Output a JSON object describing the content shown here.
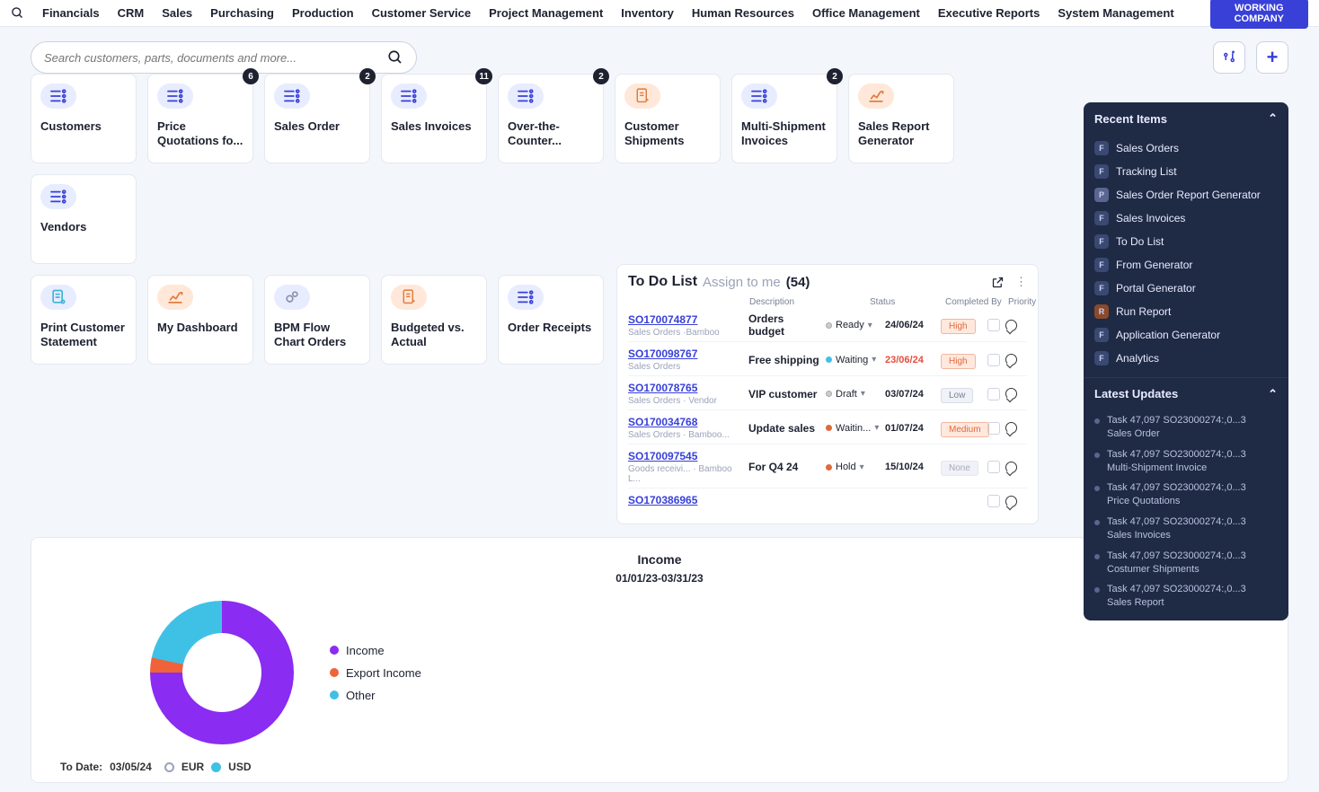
{
  "nav": [
    "Financials",
    "CRM",
    "Sales",
    "Purchasing",
    "Production",
    "Customer Service",
    "Project Management",
    "Inventory",
    "Human Resources",
    "Office Management",
    "Executive Reports",
    "System Management"
  ],
  "working_btn": "WORKING COMPANY",
  "search_placeholder": "Search customers, parts, documents and more...",
  "tiles_row1": [
    {
      "label": "Customers",
      "badge": null,
      "icon": "list"
    },
    {
      "label": "Price Quotations fo...",
      "badge": "6",
      "icon": "list"
    },
    {
      "label": "Sales Order",
      "badge": "2",
      "icon": "list"
    },
    {
      "label": "Sales Invoices",
      "badge": "11",
      "icon": "list"
    },
    {
      "label": "Over-the-Counter...",
      "badge": "2",
      "icon": "list"
    },
    {
      "label": "Customer Shipments",
      "badge": null,
      "icon": "doc",
      "orange": true
    },
    {
      "label": "Multi-Shipment Invoices",
      "badge": "2",
      "icon": "list"
    },
    {
      "label": "Sales Report Generator",
      "badge": null,
      "icon": "chart",
      "orange": true
    },
    {
      "label": "Vendors",
      "badge": null,
      "icon": "list"
    }
  ],
  "tiles_row2": [
    {
      "label": "Print Customer Statement",
      "icon": "print"
    },
    {
      "label": "My Dashboard",
      "icon": "chart",
      "orange": true
    },
    {
      "label": "BPM Flow Chart Orders",
      "icon": "gear"
    },
    {
      "label": "Budgeted vs. Actual",
      "icon": "doc",
      "orange": true
    },
    {
      "label": "Order Receipts",
      "icon": "list"
    }
  ],
  "todo": {
    "title": "To Do List",
    "sub": "Assign to me",
    "count": "(54)",
    "headers": [
      "Description",
      "Status",
      "Completed By",
      "Priority"
    ],
    "rows": [
      {
        "so": "SO170074877",
        "sub": "Sales Orders  ·Bamboo",
        "desc": "Orders budget",
        "status": "Ready",
        "sdot": "#ccc",
        "date": "24/06/24",
        "prio": "High",
        "pclass": "high"
      },
      {
        "so": "SO170098767",
        "sub": "Sales Orders",
        "desc": "Free shipping",
        "status": "Waiting",
        "sdot": "#3fc1e6",
        "date": "23/06/24",
        "dred": true,
        "prio": "High",
        "pclass": "high"
      },
      {
        "so": "SO170078765",
        "sub": "Sales Orders · Vendor",
        "desc": "VIP customer",
        "status": "Draft",
        "sdot": "#ccc",
        "date": "03/07/24",
        "prio": "Low",
        "pclass": "low"
      },
      {
        "so": "SO170034768",
        "sub": "Sales Orders · Bamboo...",
        "desc": "Update sales",
        "status": "Waitin...",
        "sdot": "#e06a3d",
        "date": "01/07/24",
        "prio": "Medium",
        "pclass": "med"
      },
      {
        "so": "SO170097545",
        "sub": "Goods receivi... · Bamboo L...",
        "desc": "For Q4 24",
        "status": "Hold",
        "sdot": "#e06a3d",
        "date": "15/10/24",
        "prio": "None",
        "pclass": "none"
      },
      {
        "so": "SO170386965",
        "sub": "",
        "desc": "",
        "status": "",
        "sdot": "",
        "date": "",
        "prio": "",
        "pclass": "none"
      }
    ]
  },
  "chart_data": {
    "type": "pie",
    "title": "Income",
    "subtitle": "01/01/23-03/31/23",
    "series": [
      {
        "name": "Income",
        "value": 75,
        "color": "#8a2cf1"
      },
      {
        "name": "Export Income",
        "value": 3,
        "color": "#f0623a"
      },
      {
        "name": "Other",
        "value": 22,
        "color": "#3fc1e6"
      }
    ],
    "footer": {
      "label": "To Date:",
      "date": "03/05/24",
      "opts": [
        "EUR",
        "USD"
      ],
      "selected": "USD"
    }
  },
  "sidebar": {
    "recent_title": "Recent Items",
    "recent": [
      {
        "b": "F",
        "t": "Sales Orders"
      },
      {
        "b": "F",
        "t": "Tracking List"
      },
      {
        "b": "P",
        "t": "Sales Order Report Generator",
        "cls": "p"
      },
      {
        "b": "F",
        "t": "Sales Invoices"
      },
      {
        "b": "F",
        "t": "To Do List"
      },
      {
        "b": "F",
        "t": "From Generator"
      },
      {
        "b": "F",
        "t": "Portal Generator"
      },
      {
        "b": "R",
        "t": "Run Report",
        "cls": "r"
      },
      {
        "b": "F",
        "t": "Application Generator"
      },
      {
        "b": "F",
        "t": "Analytics"
      }
    ],
    "updates_title": "Latest Updates",
    "updates": [
      {
        "l1": "Task 47,097 SO23000274:,0...3",
        "l2": "Sales Order"
      },
      {
        "l1": "Task 47,097 SO23000274:,0...3",
        "l2": "Multi-Shipment Invoice"
      },
      {
        "l1": "Task 47,097 SO23000274:,0...3",
        "l2": "Price Quotations"
      },
      {
        "l1": "Task 47,097 SO23000274:,0...3",
        "l2": "Sales Invoices"
      },
      {
        "l1": "Task 47,097 SO23000274:,0...3",
        "l2": "Costumer Shipments"
      },
      {
        "l1": "Task 47,097 SO23000274:,0...3",
        "l2": "Sales Report"
      }
    ]
  }
}
